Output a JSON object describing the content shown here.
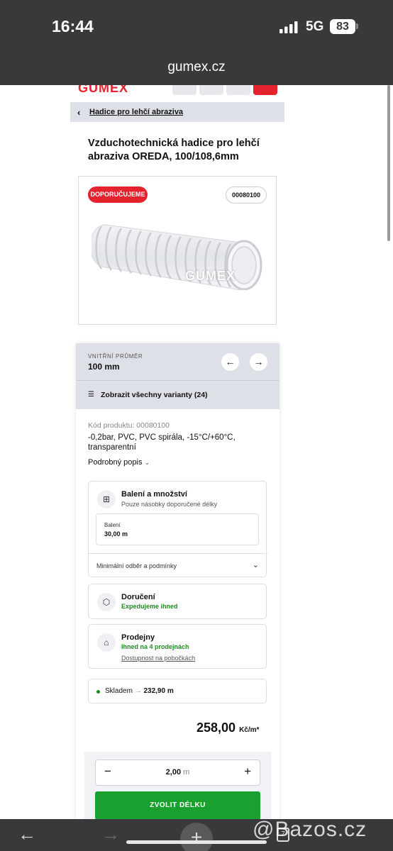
{
  "status": {
    "time": "16:44",
    "network": "5G",
    "battery": "83"
  },
  "browser": {
    "url": "gumex.cz"
  },
  "site": {
    "logo": "GUMEX"
  },
  "breadcrumb": "Hadice pro lehčí abraziva",
  "product": {
    "title": "Vzduchotechnická hadice pro lehčí abraziva OREDA, 100/108,6mm",
    "badge": "DOPORUČUJEME",
    "code_badge": "00080100",
    "watermark": "GUMEX"
  },
  "variant": {
    "label": "VNITŘNÍ PRŮMĚR",
    "value": "100 mm",
    "all_variants": "Zobrazit všechny varianty (24)"
  },
  "details": {
    "code": "Kód produktu: 00080100",
    "description": "-0,2bar, PVC, PVC spirála, -15°C/+60°C, transparentní",
    "more": "Podrobný popis"
  },
  "packaging": {
    "title": "Balení a množství",
    "subtitle": "Pouze násobky doporučené délky",
    "pack_label": "Balení",
    "pack_value": "30,00 m",
    "min_order": "Minimální odběr a podmínky"
  },
  "delivery": {
    "title": "Doručení",
    "status": "Expedujeme ihned"
  },
  "stores": {
    "title": "Prodejny",
    "status": "Ihned na 4 prodejnách",
    "link": "Dostupnost na pobočkách"
  },
  "stock": {
    "label": "Skladem",
    "value": "232,90 m"
  },
  "price": {
    "value": "258,00",
    "unit": "Kč/m*"
  },
  "quantity": {
    "value": "2,00",
    "unit": "m",
    "cta": "ZVOLIT DÉLKU"
  },
  "watermark_site": "@Bazos.cz",
  "colors": {
    "brand_red": "#e4232f",
    "green": "#19a12f",
    "panel": "#dde0e7"
  }
}
